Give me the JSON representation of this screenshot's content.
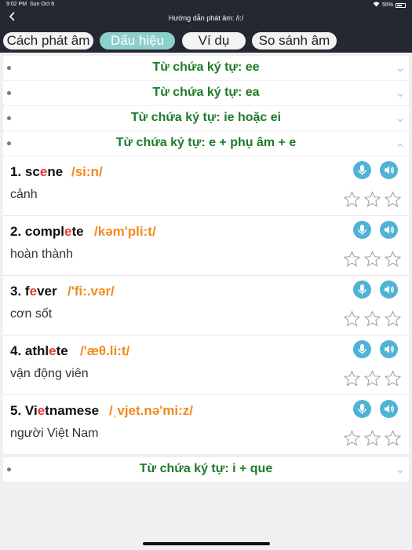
{
  "status": {
    "time": "9:02 PM",
    "date": "Sun Oct 6",
    "battery": "55%"
  },
  "nav": {
    "title": "Hướng dẫn phát âm: /i:/"
  },
  "tabs": [
    {
      "label": "Cách phát âm",
      "active": false
    },
    {
      "label": "Dấu hiệu",
      "active": true
    },
    {
      "label": "Ví dụ",
      "active": false
    },
    {
      "label": "So sánh âm",
      "active": false
    }
  ],
  "sections": [
    {
      "title": "Từ chứa ký tự: ee",
      "expanded": false
    },
    {
      "title": "Từ chứa ký tự: ea",
      "expanded": false
    },
    {
      "title": "Từ chứa ký tự: ie hoặc ei",
      "expanded": false
    },
    {
      "title": "Từ chứa ký tự: e + phụ âm + e",
      "expanded": true
    },
    {
      "title": "Từ chứa ký tự: i + que",
      "expanded": false
    }
  ],
  "items": [
    {
      "index": "1.",
      "before": "sc",
      "highlight": "e",
      "after": "ne",
      "ipa": "/si:n/",
      "meaning": "cảnh"
    },
    {
      "index": "2.",
      "before": "compl",
      "highlight": "e",
      "after": "te",
      "ipa": "/kəm'pli:t/",
      "meaning": "hoàn thành"
    },
    {
      "index": "3.",
      "before": "f",
      "highlight": "e",
      "after": "ver",
      "ipa": "/'fi:.vər/",
      "meaning": "cơn sốt"
    },
    {
      "index": "4.",
      "before": "athl",
      "highlight": "e",
      "after": "te",
      "ipa": "/'æθ.li:t/",
      "meaning": "vận động viên"
    },
    {
      "index": "5.",
      "before": "Vi",
      "highlight": "e",
      "after": "tnamese",
      "ipa": "/ˌvjet.nə'mi:z/",
      "meaning": "người Việt Nam"
    }
  ],
  "colors": {
    "header_bg": "#242830",
    "active_tab": "#8dcfca",
    "section_title": "#1f7a2a",
    "highlight": "#e23a2d",
    "ipa": "#f28a1d",
    "action_button": "#4fb3d6"
  },
  "icons": {
    "back": "chevron-left-icon",
    "mic": "microphone-icon",
    "speaker": "speaker-icon",
    "star": "star-outline-icon",
    "chevron": "chevron-down-icon"
  }
}
